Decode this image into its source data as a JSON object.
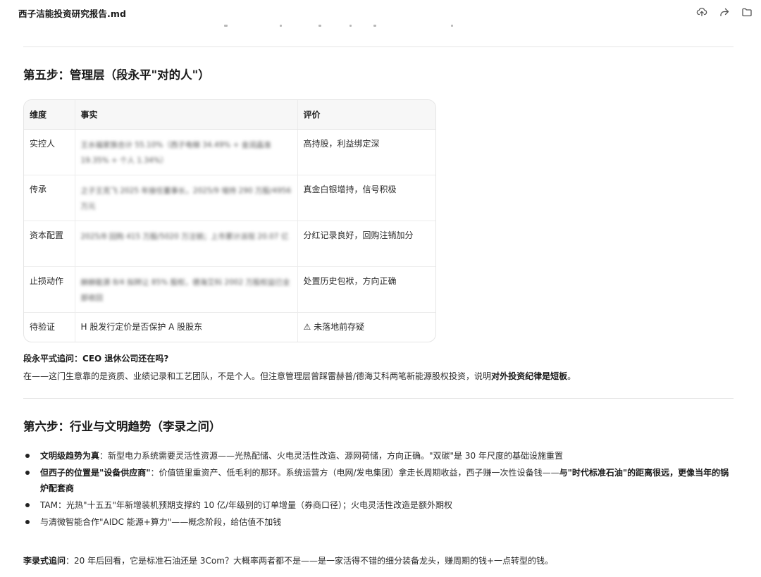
{
  "window": {
    "title": "西子洁能投资研究报告.md",
    "actions": [
      "upload-icon",
      "share-icon",
      "folder-icon"
    ]
  },
  "section5": {
    "heading": "第五步：管理层（段永平\"对的人\"）",
    "table": {
      "headers": [
        "维度",
        "事实",
        "评价"
      ],
      "rows": [
        {
          "dim": "实控人",
          "fact": "王水福家族合计 55.10%（西子电梯 34.49% + 金润晶准 19.35% + 个人 1.34%）",
          "eval": "高持股，利益绑定深"
        },
        {
          "dim": "传承",
          "fact": "之子王克飞 2025 年接任董事长，2025/9 增持 290 万股/4956 万元",
          "eval": "真金白银增持，信号积极"
        },
        {
          "dim": "资本配置",
          "fact": "2025/8 回购 415 万股/5020 万注销；上市累计派现 20.07 亿",
          "eval": "分红记录良好，回购注销加分"
        },
        {
          "dim": "止损动作",
          "fact": "赫赫能源 8/4 拟转让 85% 股权，德海艾科 2002 万股权益已全部收回",
          "eval": "处置历史包袱，方向正确"
        },
        {
          "dim": "待验证",
          "fact": "H 股发行定价是否保护 A 股股东",
          "eval": "⚠ 未落地前存疑"
        }
      ]
    },
    "followup_label": "段永平式追问：",
    "followup_q": "CEO 退休公司还在吗?",
    "answer_pre": "在——这门生意靠的是资质、业绩记录和工艺团队，不是个人。但注意管理层曾踩雷赫普/德海艾科两笔新能源股权投资，说明",
    "answer_bold": "对外投资纪律是短板",
    "answer_post": "。"
  },
  "section6": {
    "heading": "第六步：行业与文明趋势（李录之问）",
    "bullets": [
      {
        "bold": "文明级趋势为真",
        "text": "：新型电力系统需要灵活性资源——光热配储、火电灵活性改造、源网荷储，方向正确。\"双碳\"是 30 年尺度的基础设施重置"
      },
      {
        "bold": "但西子的位置是\"设备供应商\"",
        "text": "：价值链里重资产、低毛利的那环。系统运营方（电网/发电集团）拿走长周期收益，西子赚一次性设备钱——",
        "bold2": "与\"时代标准石油\"的距离很远，更像当年的锅炉配套商"
      },
      {
        "bold": "",
        "text": "TAM：光热\"十五五\"年新增装机预期支撑约 10 亿/年级别的订单增量（券商口径）；火电灵活性改造是额外期权"
      },
      {
        "bold": "",
        "text": "与清微智能合作\"AIDC 能源+算力\"——概念阶段，给估值不加钱"
      }
    ],
    "followup_label": "李录式追问",
    "followup_text": "：20 年后回看，它是标准石油还是 3Com？大概率两者都不是——是一家活得不错的细分装备龙头，赚周期的钱+一点转型的钱。"
  }
}
